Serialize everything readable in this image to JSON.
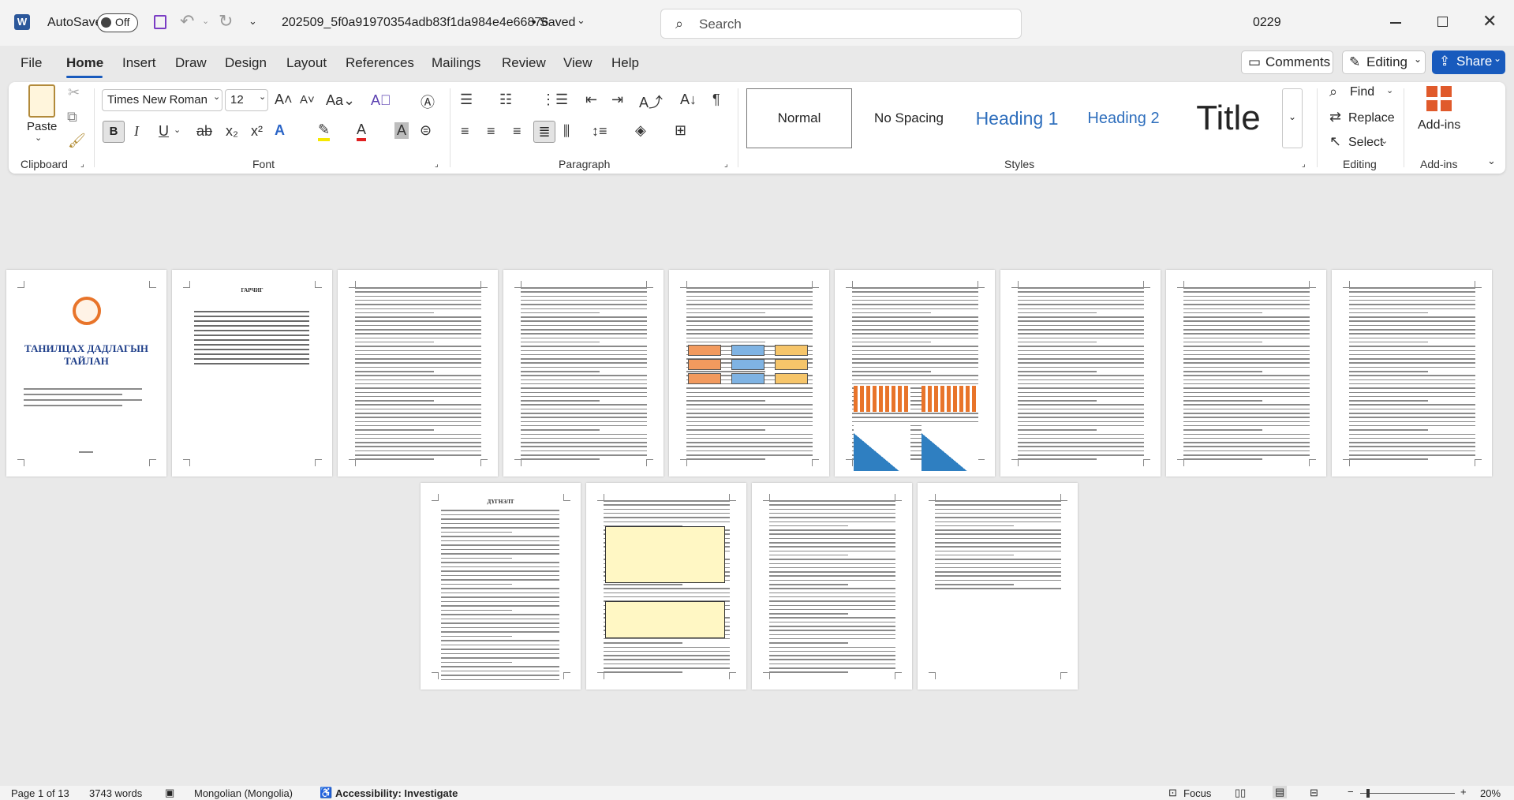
{
  "titlebar": {
    "autosave_label": "AutoSave",
    "autosave_state": "Off",
    "doc_title": "202509_5f0a91970354adb83f1da984e4e66876",
    "save_state": "• Saved",
    "search_placeholder": "Search",
    "user_initials": "0229"
  },
  "menu": {
    "tabs": [
      "File",
      "Home",
      "Insert",
      "Draw",
      "Design",
      "Layout",
      "References",
      "Mailings",
      "Review",
      "View",
      "Help"
    ],
    "comments_label": "Comments",
    "editing_label": "Editing",
    "share_label": "Share"
  },
  "ribbon": {
    "clipboard": {
      "paste": "Paste",
      "label": "Clipboard"
    },
    "font": {
      "family": "Times New Roman",
      "size": "12",
      "label": "Font"
    },
    "paragraph": {
      "label": "Paragraph"
    },
    "styles": {
      "items": [
        "Normal",
        "No Spacing",
        "Heading 1",
        "Heading 2",
        "Title"
      ],
      "label": "Styles"
    },
    "editing": {
      "find": "Find",
      "replace": "Replace",
      "select": "Select",
      "label": "Editing"
    },
    "addins": {
      "button": "Add-ins",
      "label": "Add-ins"
    }
  },
  "document": {
    "cover_title": "ТАНИЛЦАХ ДАДЛАГЫН ТАЙЛАН",
    "toc_title": "ГАРЧИГ",
    "conclusion_title": "ДҮГНЭЛТ"
  },
  "status": {
    "page": "Page 1 of 13",
    "words": "3743 words",
    "language": "Mongolian (Mongolia)",
    "accessibility": "Accessibility: Investigate",
    "focus": "Focus",
    "zoom": "20%"
  },
  "colors": {
    "accent": "#185abd",
    "brand": "#2b579a",
    "cover_blue": "#1f3f8a",
    "logo_orange": "#e8742a"
  }
}
